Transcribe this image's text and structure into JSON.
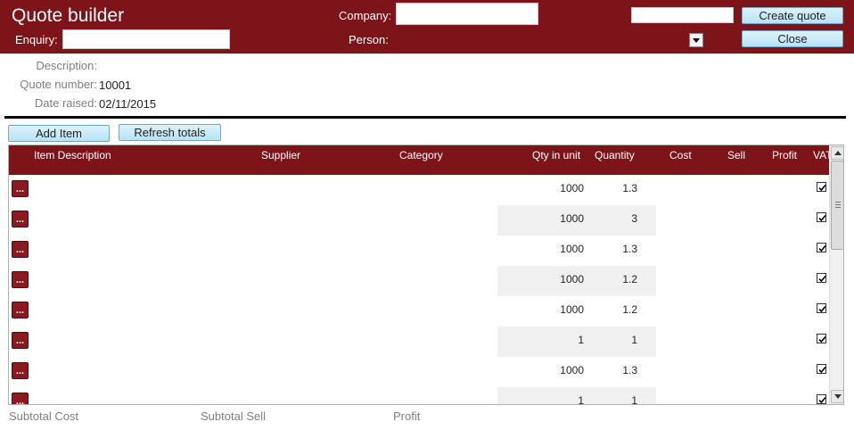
{
  "header": {
    "title": "Quote builder",
    "company_label": "Company:",
    "company_value": "",
    "enquiry_label": "Enquiry:",
    "enquiry_value": "",
    "person_label": "Person:",
    "search_value": "",
    "create_quote_label": "Create quote",
    "close_label": "Close"
  },
  "info": {
    "description_label": "Description:",
    "description_value": "",
    "quote_number_label": "Quote number:",
    "quote_number_value": "10001",
    "date_raised_label": "Date raised:",
    "date_raised_value": "02/11/2015"
  },
  "toolbar": {
    "add_item_label": "Add Item",
    "refresh_totals_label": "Refresh totals"
  },
  "grid": {
    "columns": [
      "Item Description",
      "Supplier",
      "Category",
      "Qty in unit",
      "Quantity",
      "Cost",
      "Sell",
      "Profit",
      "VAT"
    ],
    "row_button_label": "...",
    "rows": [
      {
        "qty_in_unit": "1000",
        "quantity": "1.3",
        "vat": true
      },
      {
        "qty_in_unit": "1000",
        "quantity": "3",
        "vat": true
      },
      {
        "qty_in_unit": "1000",
        "quantity": "1.3",
        "vat": true
      },
      {
        "qty_in_unit": "1000",
        "quantity": "1.2",
        "vat": true
      },
      {
        "qty_in_unit": "1000",
        "quantity": "1.2",
        "vat": true
      },
      {
        "qty_in_unit": "1",
        "quantity": "1",
        "vat": true
      },
      {
        "qty_in_unit": "1000",
        "quantity": "1.3",
        "vat": true
      },
      {
        "qty_in_unit": "1",
        "quantity": "1",
        "vat": true
      }
    ]
  },
  "footer": {
    "subtotal_cost_label": "Subtotal Cost",
    "subtotal_sell_label": "Subtotal Sell",
    "profit_label": "Profit"
  },
  "colors": {
    "header_bg": "#7d1419",
    "button_bg": "#b7e3f6",
    "row_alt_bg": "#f0f0f0"
  }
}
